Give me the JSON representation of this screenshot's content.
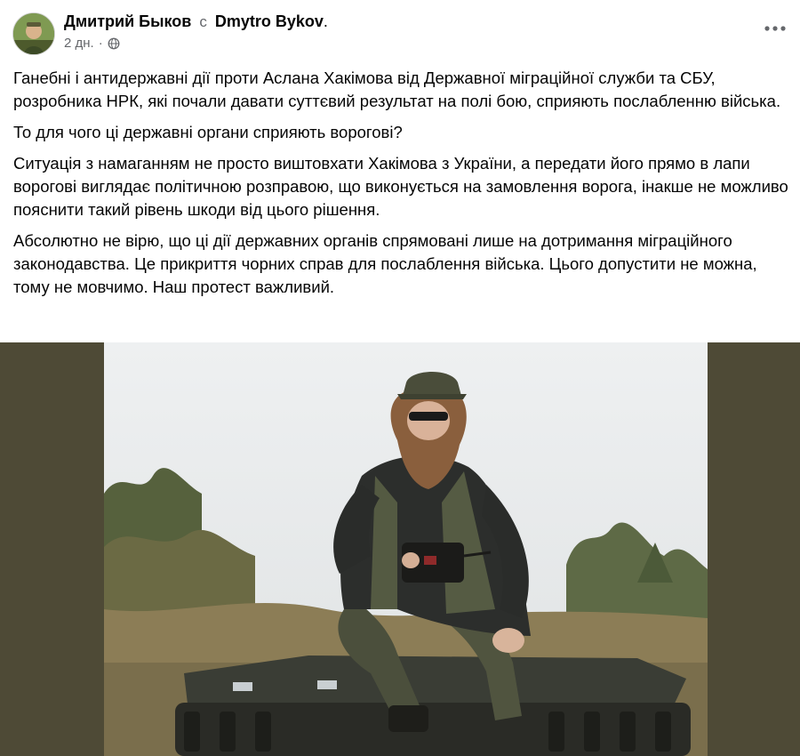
{
  "header": {
    "author": "Дмитрий Быков",
    "separator": "с",
    "with_user": "Dmytro Bykov",
    "trailing": ".",
    "time": "2 дн.",
    "dot": "·",
    "privacy_icon": "globe-icon",
    "more_icon": "more-options-icon"
  },
  "post": {
    "paragraphs": [
      "Ганебні і антидержавні дії проти Аслана Хакімова від Державної міграційної служби та СБУ, розробника НРК, які почали давати суттєвий результат на полі бою, сприяють послабленню війська.",
      "То для чого ці державні органи сприяють ворогові?",
      "Ситуація з намаганням не просто виштовхати Хакімова з України, а передати його прямо в лапи ворогові виглядає політичною розправою, що виконується на замовлення ворога, інакше не можливо пояснити такий рівень шкоди від цього рішення.",
      "Абсолютно не вірю, що ці дії державних органів спрямовані лише на дотримання міграційного законодавства. Це прикриття чорних справ для послаблення війська. Цього допустити не можна, тому не мовчимо. Наш протест важливий."
    ]
  },
  "colors": {
    "text": "#050505",
    "secondary": "#65676b",
    "media_background": "#4e4a36"
  }
}
